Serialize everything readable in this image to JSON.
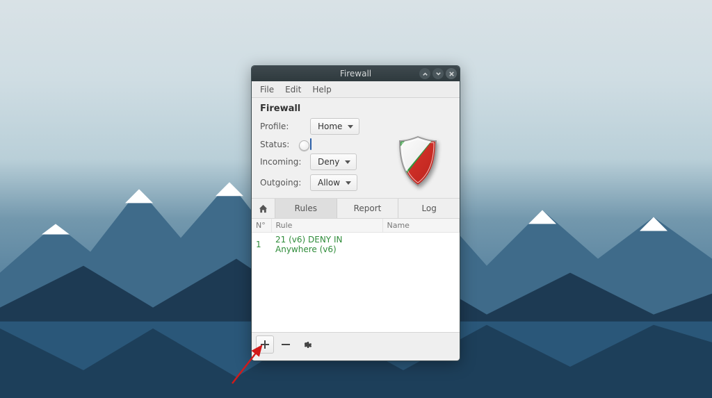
{
  "window": {
    "title": "Firewall"
  },
  "menubar": {
    "file": "File",
    "edit": "Edit",
    "help": "Help"
  },
  "heading": "Firewall",
  "profile": {
    "label": "Profile:",
    "value": "Home"
  },
  "status": {
    "label": "Status:"
  },
  "incoming": {
    "label": "Incoming:",
    "value": "Deny"
  },
  "outgoing": {
    "label": "Outgoing:",
    "value": "Allow"
  },
  "tabs": {
    "rules": "Rules",
    "report": "Report",
    "log": "Log"
  },
  "columns": {
    "no": "N°",
    "rule": "Rule",
    "name": "Name"
  },
  "rows": [
    {
      "no": "1",
      "rule": "21 (v6) DENY IN Anywhere (v6)",
      "name": ""
    }
  ]
}
